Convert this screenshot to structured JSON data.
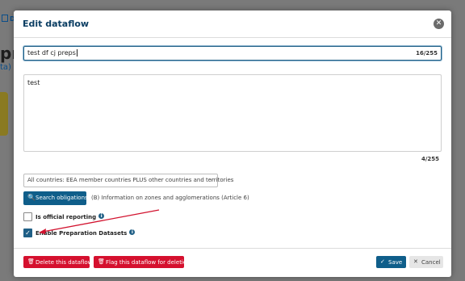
{
  "background": {
    "tab_label": "D",
    "title_fragment": "pr",
    "subtitle_fragment": "ta)"
  },
  "modal": {
    "title": "Edit dataflow",
    "close_glyph": "✕",
    "name_field": {
      "value": "test df cj preps",
      "counter": "16/255"
    },
    "description_field": {
      "value": "test",
      "counter": "4/255"
    },
    "region_select": {
      "selected": "All countries: EEA member countries PLUS other countries and territories",
      "chevron_glyph": "⌵"
    },
    "search_obligations": {
      "label": "Search obligations",
      "icon_glyph": "🔍"
    },
    "obligation": "(B) Information on zones and agglomerations (Article 6)",
    "checkboxes": [
      {
        "label": "Is official reporting",
        "checked": false,
        "info_glyph": "i"
      },
      {
        "label": "Enable Preparation Datasets",
        "checked": true,
        "check_glyph": "✓",
        "info_glyph": "i"
      }
    ],
    "footer": {
      "delete_label": "Delete this dataflow",
      "flag_label": "Flag this dataflow for deletion",
      "save_label": "Save",
      "cancel_label": "Cancel",
      "trash_glyph": "🗑",
      "save_glyph": "✓",
      "cancel_glyph": "✕"
    }
  },
  "colors": {
    "primary": "#0f5e8a",
    "danger": "#d5102e",
    "annotation_arrow": "#d2122e"
  },
  "icons": [
    "search-icon",
    "close-icon",
    "trash-icon",
    "check-icon",
    "info-icon",
    "chevron-down-icon"
  ]
}
